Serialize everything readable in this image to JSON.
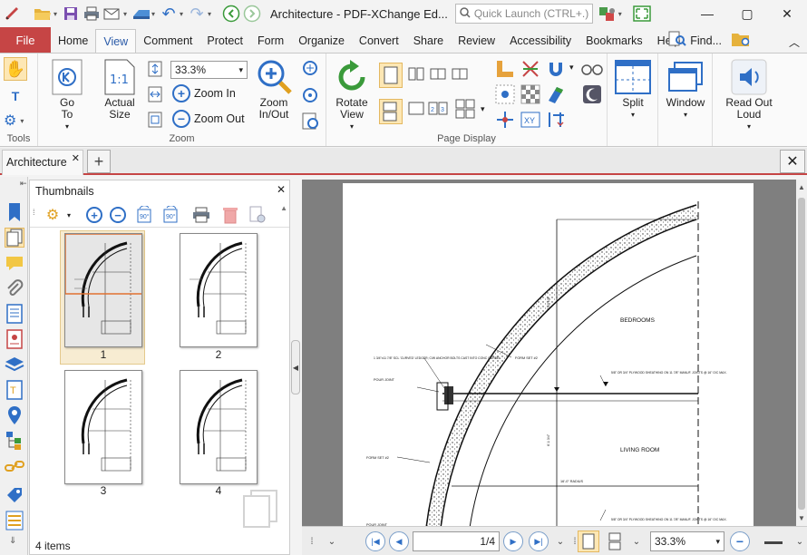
{
  "window": {
    "title": "Architecture - PDF-XChange Ed...",
    "quick_launch_placeholder": "Quick Launch (CTRL+.)"
  },
  "ribbon_tabs": [
    "File",
    "Home",
    "View",
    "Comment",
    "Protect",
    "Form",
    "Organize",
    "Convert",
    "Share",
    "Review",
    "Accessibility",
    "Bookmarks",
    "Help"
  ],
  "active_tab": "View",
  "find_label": "Find...",
  "groups": {
    "tools": "Tools",
    "zoom": "Zoom",
    "page_display": "Page Display"
  },
  "buttons": {
    "go_to": "Go To",
    "actual_size": "Actual Size",
    "zoom_in": "Zoom In",
    "zoom_out": "Zoom Out",
    "zoom_in_out": "Zoom In/Out",
    "rotate_view": "Rotate View",
    "split": "Split",
    "window": "Window",
    "read_out_loud": "Read Out Loud"
  },
  "zoom_value": "33.3%",
  "document_tab": "Architecture",
  "thumbnails": {
    "title": "Thumbnails",
    "pages": [
      "1",
      "2",
      "3",
      "4"
    ],
    "selected": "1",
    "count_status": "4 items"
  },
  "navigation": {
    "page_indicator": "1/4",
    "zoom_value": "33.3%"
  },
  "drawing": {
    "labels": [
      "BEDROOMS",
      "LIVING ROOM",
      "FORM SET #2",
      "FORM SET #2",
      "POUR JOINT",
      "POUR JOINT",
      "16'-0\" RADIUS",
      "1 3/4\"x11 7/8\" SCL 'CURVED' LEDGER; C/W ANCHOR BOLTS CAST INTO CONC CORBEL",
      "5/8\" OR 3/4\" PLYWOOD SHEATHING ON 11 7/8\" MANUF. JOISTS @ 16\" O/C MAX.",
      "5/8\" OR 3/4\" PLYWOOD SHEATHING ON 11 7/8\" MANUF. JOISTS @ 16\" O/C MAX.",
      "8'-10 1/8\"",
      "6'-1 3/4\""
    ]
  },
  "colors": {
    "accent": "#c64545",
    "blue": "#2f6fc6",
    "selection": "#f7ecd2"
  }
}
